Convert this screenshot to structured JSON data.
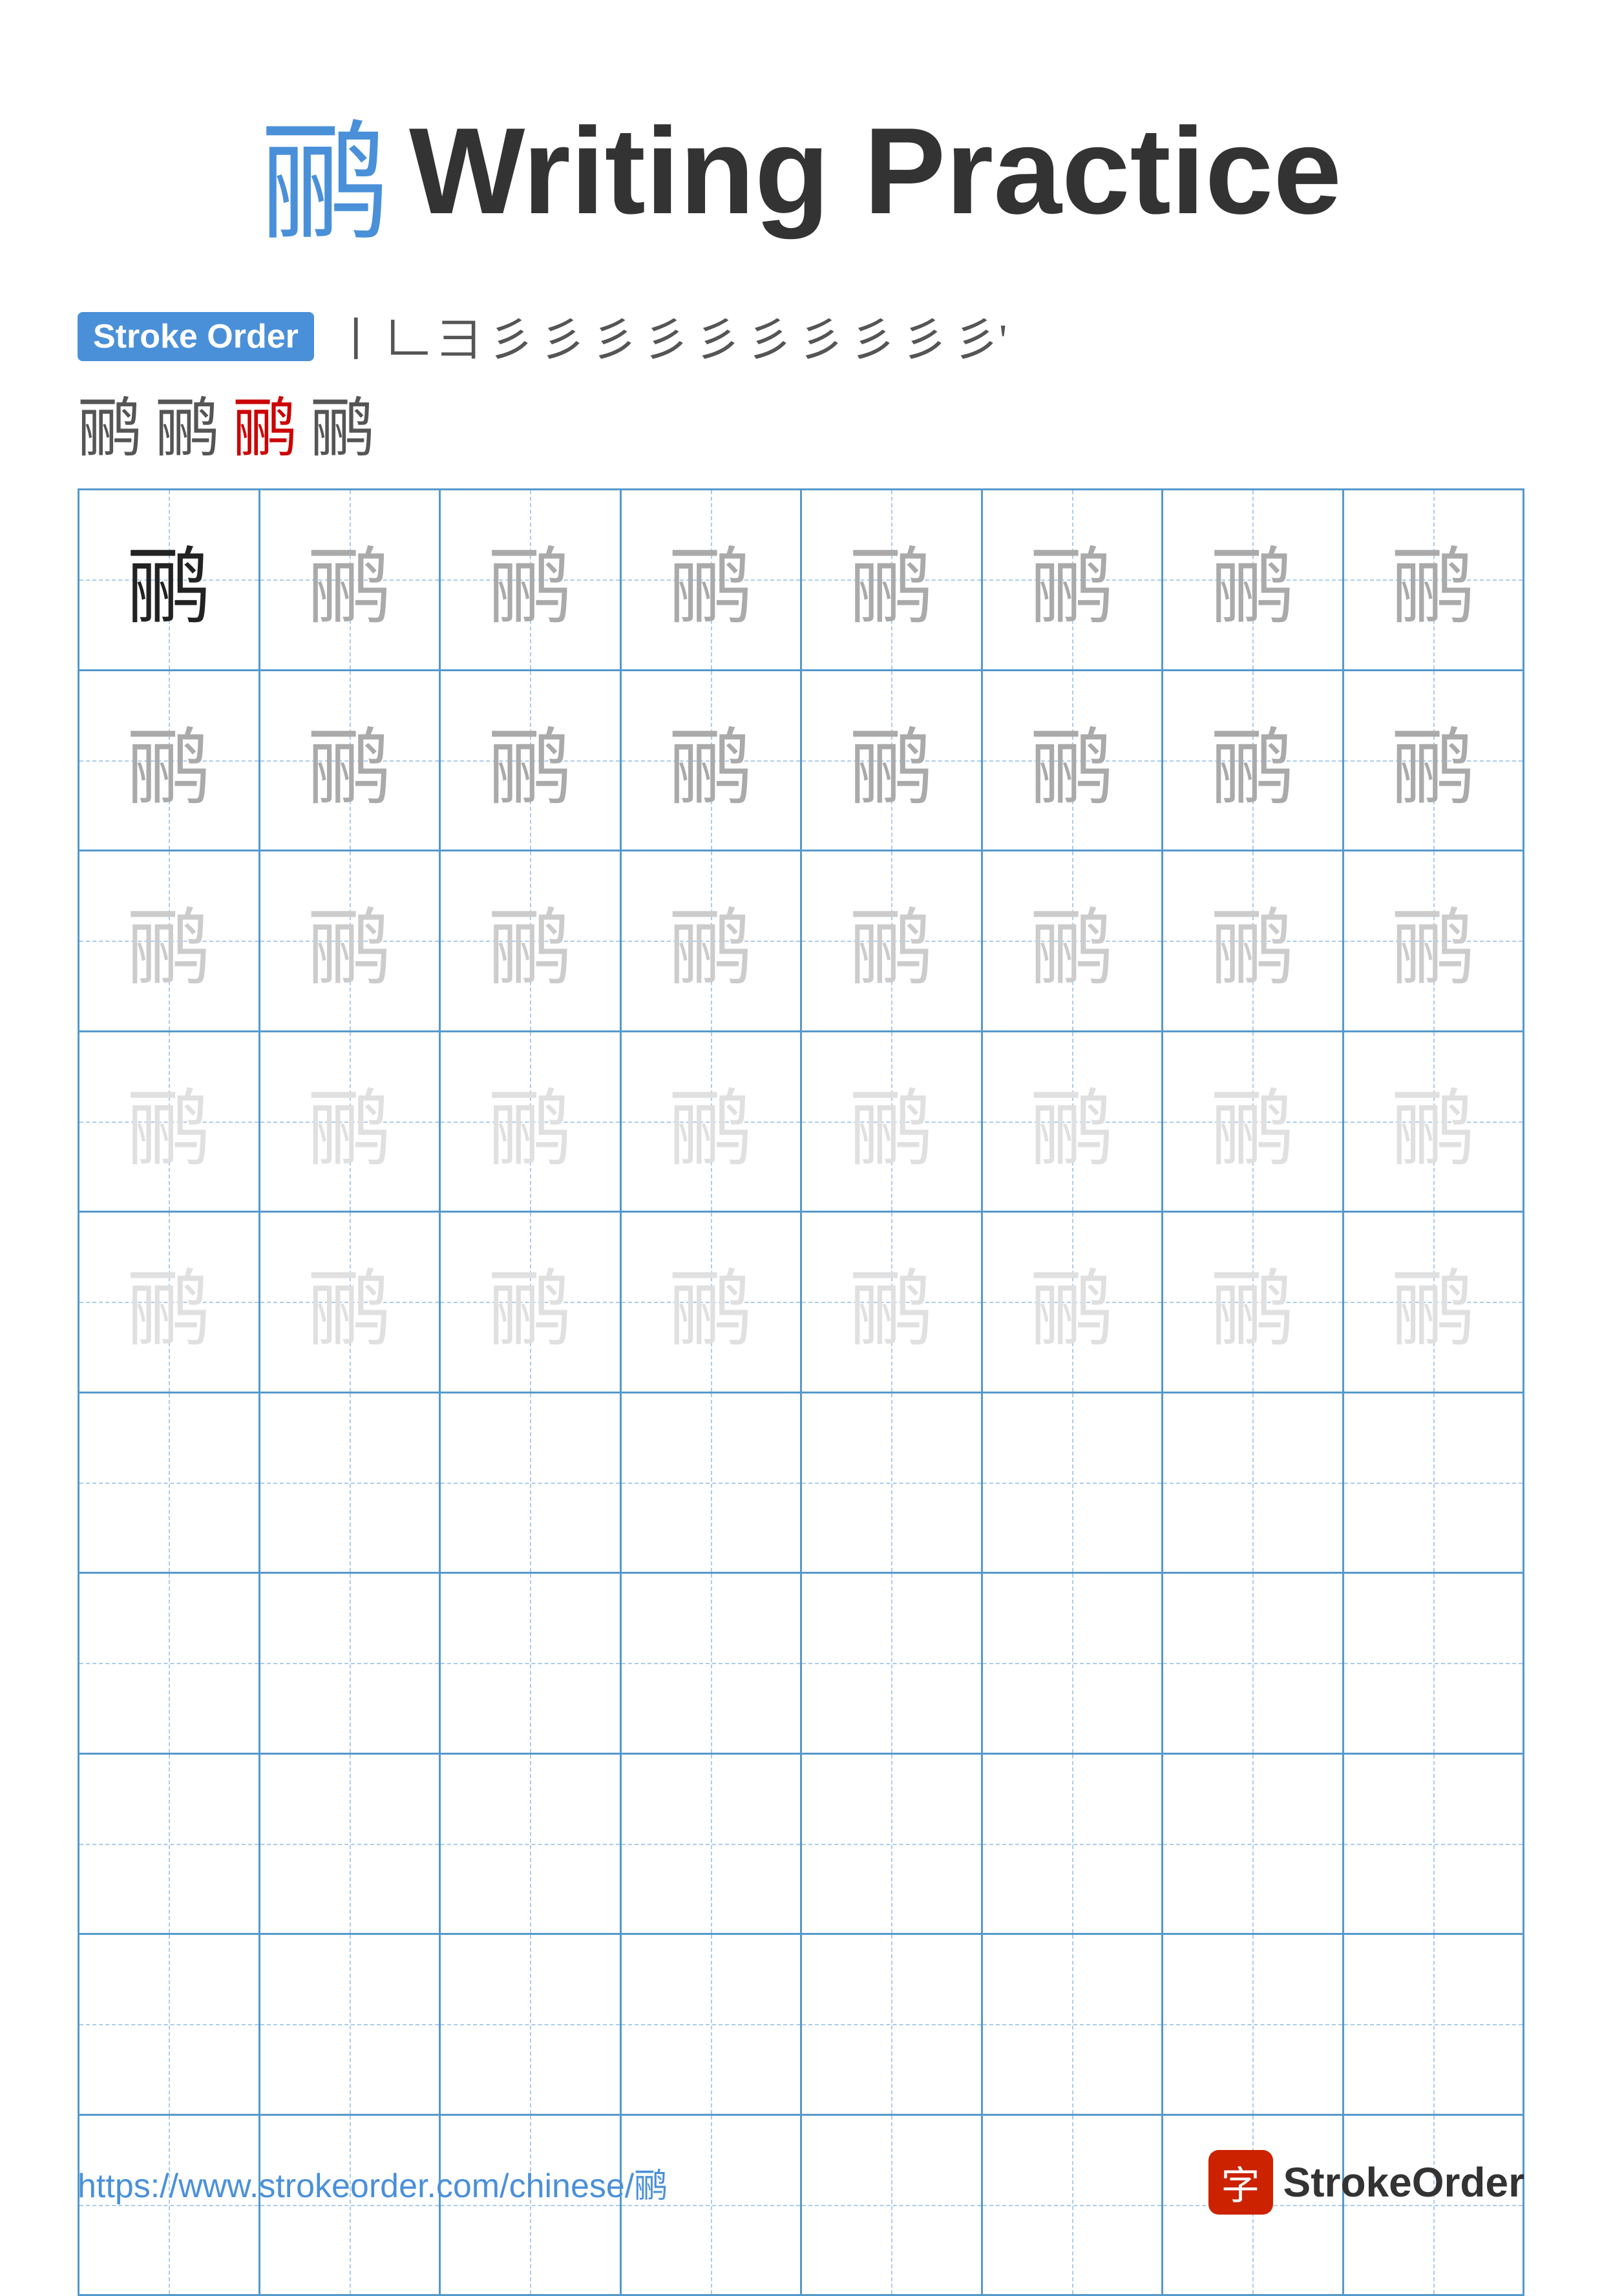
{
  "title": {
    "char": "鹂",
    "text": "Writing Practice"
  },
  "stroke_order": {
    "badge_label": "Stroke Order",
    "strokes": [
      "丨",
      "𠃊",
      "彐",
      "彡",
      "彡",
      "彡",
      "彡",
      "彡",
      "彡",
      "彡",
      "彡",
      "彡",
      "彡"
    ],
    "preview_chars": [
      "鹂",
      "鹂",
      "鹂",
      "鹂"
    ],
    "preview_colors": [
      "normal",
      "normal",
      "red",
      "normal"
    ]
  },
  "grid": {
    "character": "鹂",
    "rows": 10,
    "cols": 8,
    "filled_rows": 5,
    "opacity_levels": [
      "dark",
      "medium",
      "light",
      "very-light",
      "very-light"
    ]
  },
  "footer": {
    "url": "https://www.strokeorder.com/chinese/鹂",
    "logo_icon": "字",
    "logo_text": "StrokeOrder"
  }
}
